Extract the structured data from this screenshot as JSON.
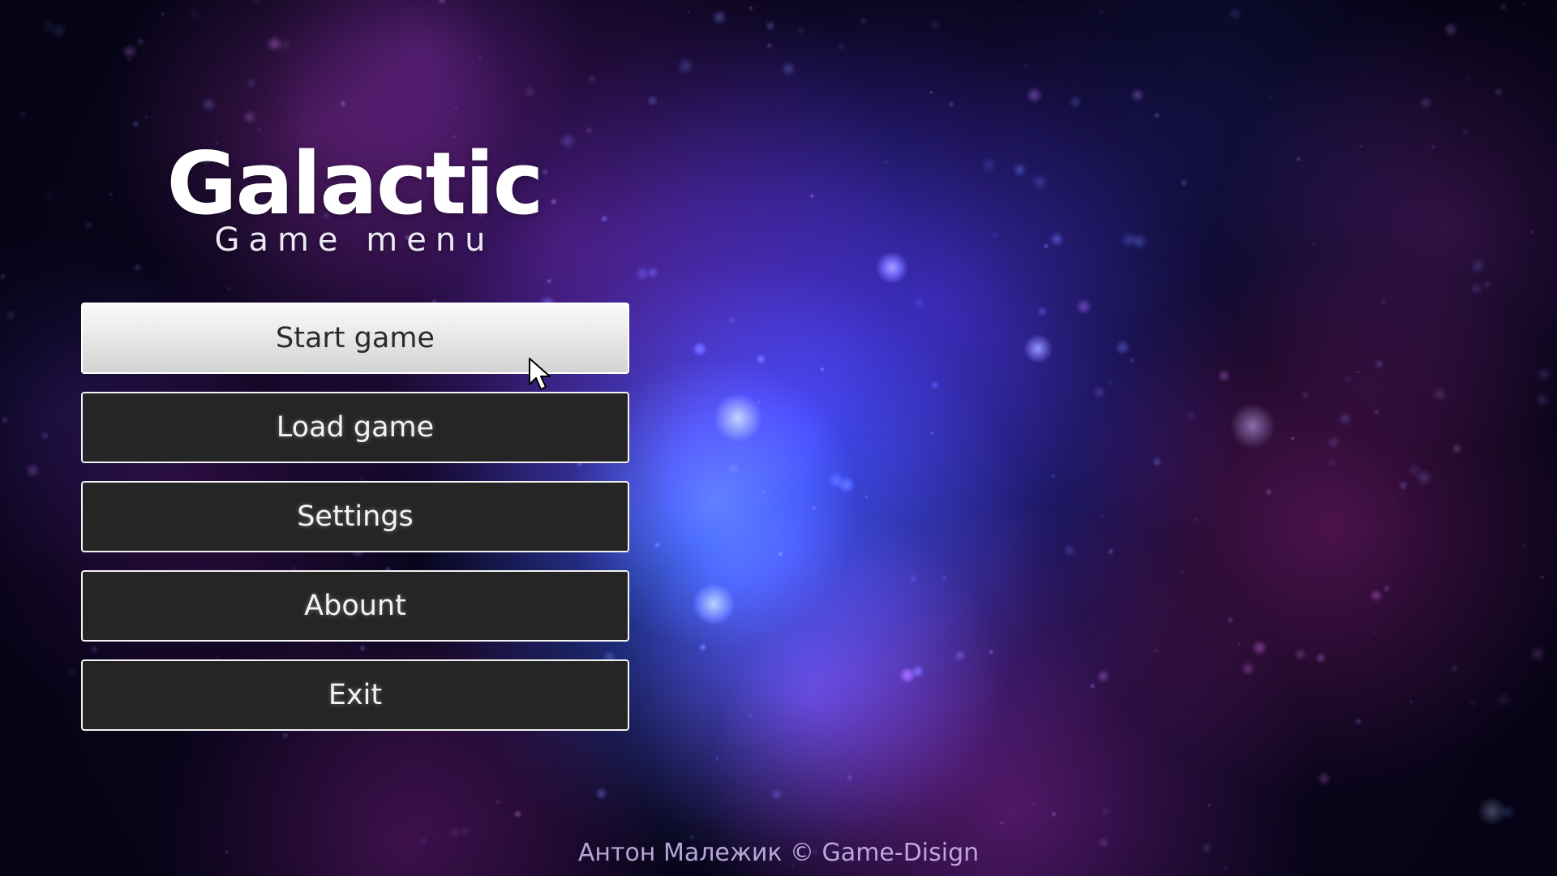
{
  "game": {
    "title": "Galactic",
    "subtitle": "Game menu"
  },
  "menu": {
    "items": [
      {
        "label": "Start game",
        "state": "hover"
      },
      {
        "label": "Load game"
      },
      {
        "label": "Settings"
      },
      {
        "label": "Abount"
      },
      {
        "label": "Exit"
      }
    ]
  },
  "footer": {
    "text": "Антон Малежик © Game-Disign"
  },
  "theme": {
    "button_bg": "#252525",
    "button_border": "#f2f2f2",
    "active_button_bg": "#e8e8e8",
    "background_base": "#0a0620"
  },
  "icons": {
    "cursor": "mouse-pointer-icon"
  }
}
